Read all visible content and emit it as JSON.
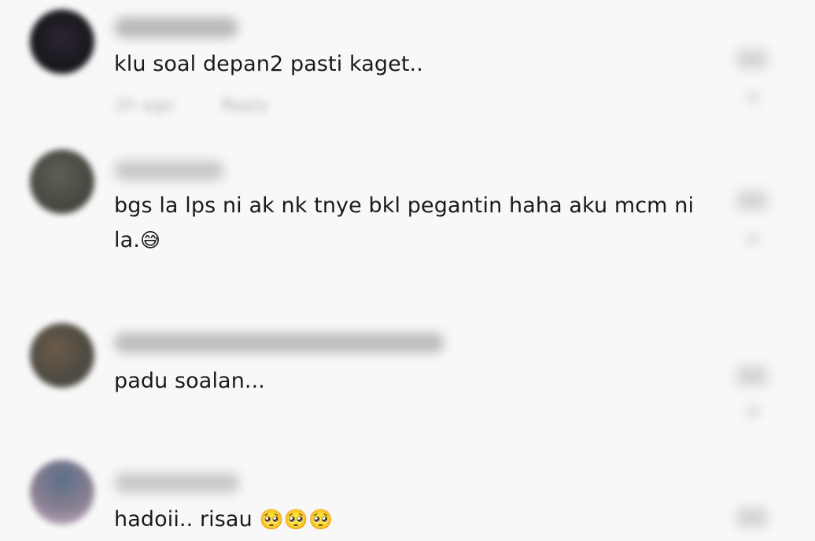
{
  "comments": [
    {
      "username": "ᵃʳ•ᵒʳᵒᵒᵉ",
      "text": "klu soal depan2 pasti kaget..",
      "time": "2h ago",
      "reply_label": "Reply",
      "avatar_color": "#1e1a20"
    },
    {
      "username": "",
      "text_line1": "bgs la lps ni ak nk tnye bkl pegantin haha aku mcm ni",
      "text_line2": "la.",
      "emoji": "😅",
      "time": "",
      "reply_label": "",
      "avatar_color": "#4d4f48"
    },
    {
      "username": "",
      "text": "padu soalan...",
      "time": "",
      "reply_label": "",
      "avatar_color": "#5a4f44"
    },
    {
      "username": "",
      "text": "hadoii.. risau",
      "emojis": "🥺🥺🥺",
      "avatar_color": "#6f6f88"
    }
  ],
  "colors": {
    "background": "#f8f8f8",
    "text": "#1a1a1a",
    "muted": "#b4b4b4"
  },
  "icons": [
    "heart-icon"
  ]
}
